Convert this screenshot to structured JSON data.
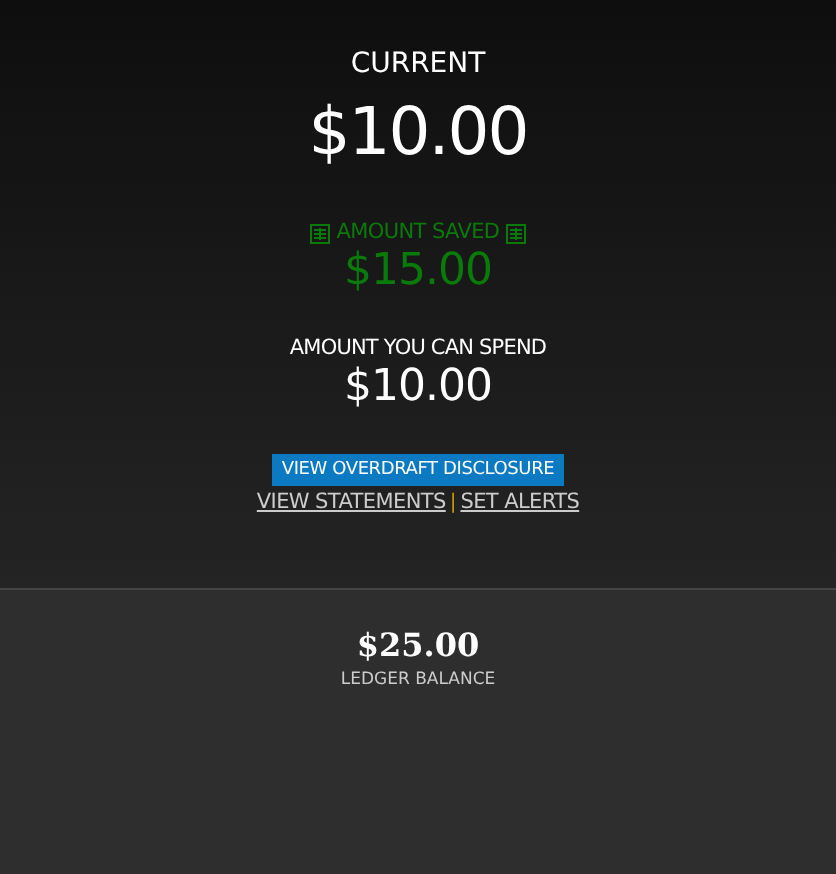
{
  "current": {
    "label": "CURRENT",
    "amount": "$10.00"
  },
  "saved": {
    "label": "AMOUNT SAVED",
    "amount": "$15.00"
  },
  "spend": {
    "label": "AMOUNT YOU CAN SPEND",
    "amount": "$10.00"
  },
  "disclosure_button": "VIEW OVERDRAFT DISCLOSURE",
  "links": [
    "VIEW STATEMENTS",
    "SET ALERTS"
  ],
  "separator": "|",
  "ledger": {
    "amount": "$25.00",
    "label": "LEDGER BALANCE"
  }
}
